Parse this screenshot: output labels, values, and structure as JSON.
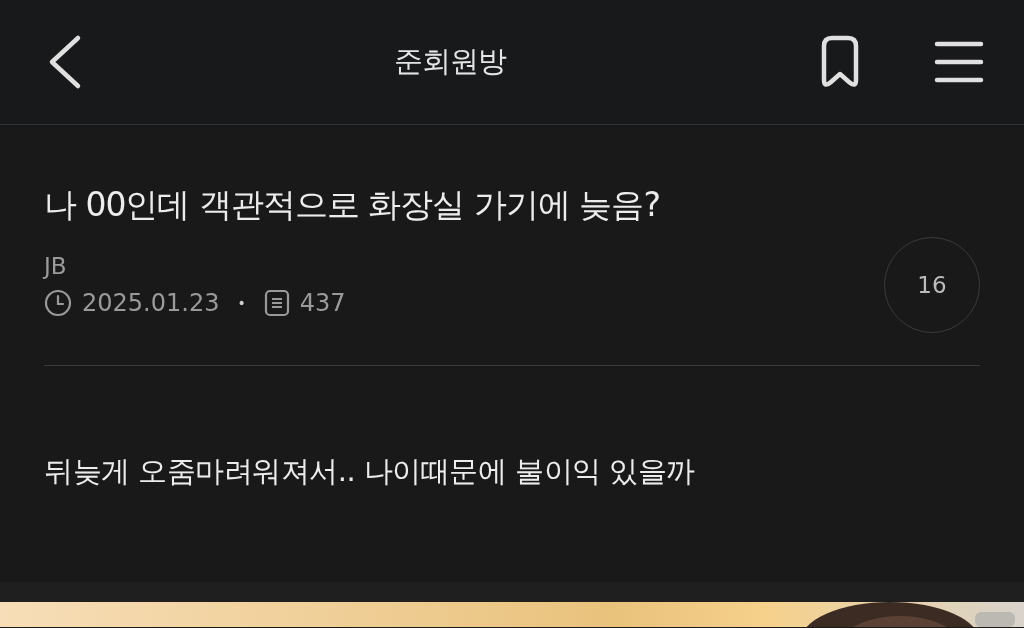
{
  "header": {
    "title": "준회원방"
  },
  "post": {
    "title": "나 00인데 객관적으로 화장실 가기에 늦음?",
    "author": "JB",
    "date": "2025.01.23",
    "separator": "•",
    "views": "437",
    "comment_count": "16",
    "body": "뒤늦게 오줌마려워져서.. 나이때문에 불이익 있을까"
  }
}
